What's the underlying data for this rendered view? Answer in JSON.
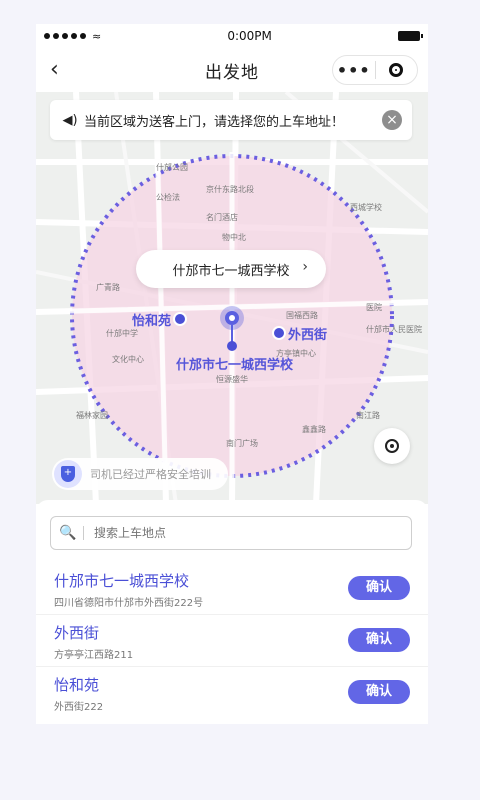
{
  "status_bar": {
    "time": "0:00PM"
  },
  "navbar": {
    "back_icon": "chevron-left-icon",
    "title": "出发地",
    "more_icon": "more-dots-icon",
    "close_icon": "target-circle-icon"
  },
  "notice": {
    "text": "当前区域为送客上门，请选择您的上车地址！"
  },
  "map": {
    "callout": "什邡市七一城西学校",
    "labels": {
      "yihe": "怡和苑",
      "waixi": "外西街",
      "school": "什邡市七一城西学校"
    },
    "small_labels": [
      "广青路",
      "什邡市七一城西学校",
      "什邡公园",
      "京什东路北段",
      "怡和苑",
      "公检法",
      "名门酒店",
      "恒源盛华",
      "方亭镇中心",
      "西城学校",
      "医院",
      "南江路",
      "方亭街道",
      "物中北",
      "国福西路",
      "什邡市人民医院",
      "中城东路",
      "什邡中学",
      "文化中心",
      "鑫鑫路",
      "北京大道",
      "福林家园",
      "南门广场",
      "汉家路"
    ]
  },
  "safety": {
    "text": "司机已经过严格安全培训"
  },
  "sheet": {
    "search_placeholder": "搜索上车地点",
    "places": [
      {
        "name": "什邡市七一城西学校",
        "address": "四川省德阳市什邡市外西街222号",
        "button": "确认"
      },
      {
        "name": "外西街",
        "address": "方亭亭江西路211",
        "button": "确认"
      },
      {
        "name": "怡和苑",
        "address": "外西街222",
        "button": "确认"
      }
    ]
  },
  "colors": {
    "accent": "#5a5fe0",
    "zone_fill": "#f6d6e4",
    "zone_border": "#6b5fe0"
  }
}
